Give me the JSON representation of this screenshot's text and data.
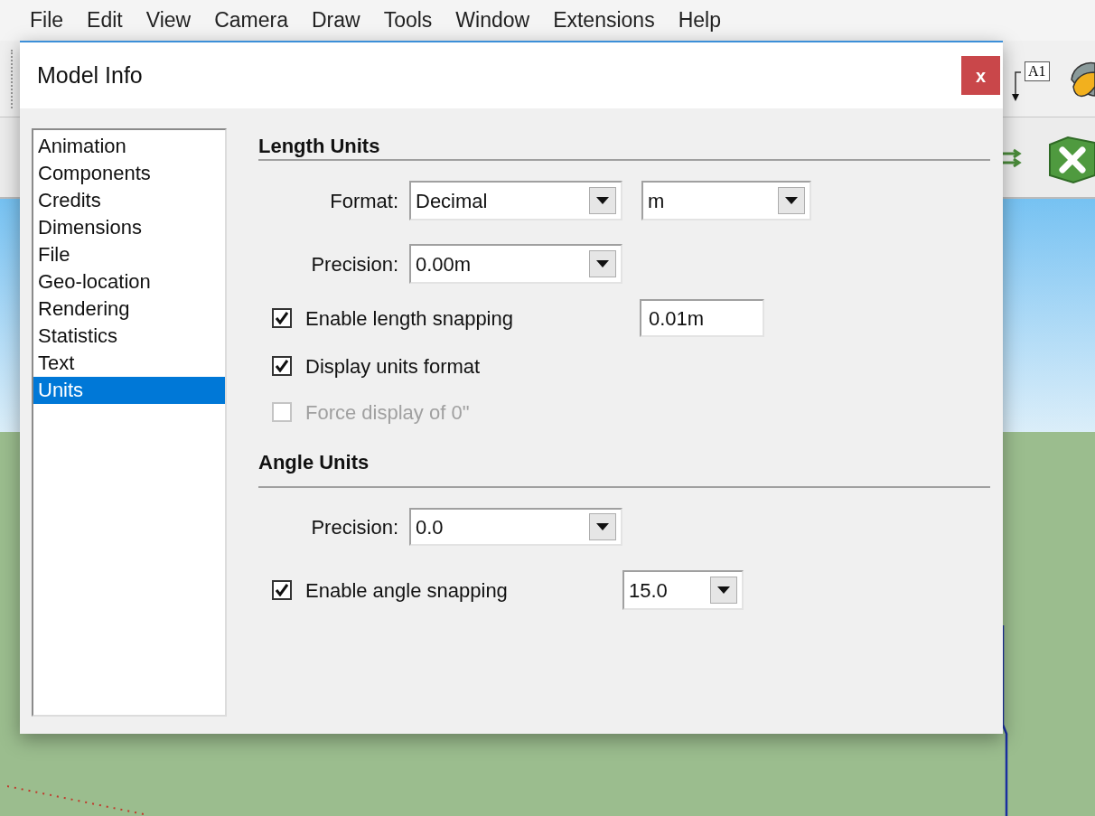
{
  "menu_bar": [
    "File",
    "Edit",
    "View",
    "Camera",
    "Draw",
    "Tools",
    "Window",
    "Extensions",
    "Help"
  ],
  "toolbar": {
    "text_tool_label": "A1"
  },
  "dialog": {
    "title": "Model Info",
    "close_label": "x",
    "sidebar": {
      "items": [
        {
          "label": "Animation",
          "selected": false
        },
        {
          "label": "Components",
          "selected": false
        },
        {
          "label": "Credits",
          "selected": false
        },
        {
          "label": "Dimensions",
          "selected": false
        },
        {
          "label": "File",
          "selected": false
        },
        {
          "label": "Geo-location",
          "selected": false
        },
        {
          "label": "Rendering",
          "selected": false
        },
        {
          "label": "Statistics",
          "selected": false
        },
        {
          "label": "Text",
          "selected": false
        },
        {
          "label": "Units",
          "selected": true
        }
      ]
    },
    "length_units": {
      "heading": "Length Units",
      "format": {
        "label": "Format:",
        "value": "Decimal",
        "unit": "m"
      },
      "precision": {
        "label": "Precision:",
        "value": "0.00m"
      },
      "options": [
        {
          "kind": "checkbox-field",
          "label": "Enable length snapping",
          "checked": true,
          "disabled": false,
          "value": "0.01m"
        },
        {
          "kind": "checkbox",
          "label": "Display units format",
          "checked": true,
          "disabled": false
        },
        {
          "kind": "checkbox",
          "label": "Force display of 0\"",
          "checked": false,
          "disabled": true
        }
      ]
    },
    "angle_units": {
      "heading": "Angle Units",
      "precision": {
        "label": "Precision:",
        "value": "0.0"
      },
      "options": [
        {
          "kind": "checkbox-select",
          "label": "Enable angle snapping",
          "checked": true,
          "disabled": false,
          "value": "15.0"
        }
      ]
    }
  }
}
